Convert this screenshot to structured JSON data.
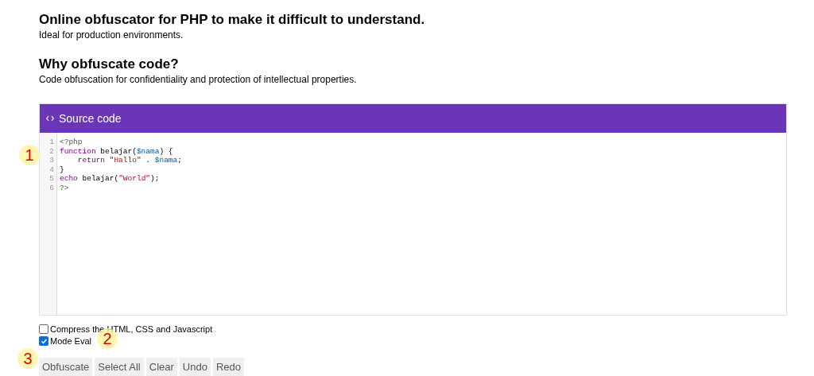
{
  "title": "Online obfuscator for PHP to make it difficult to understand.",
  "subtitle": "Ideal for production environments.",
  "why_heading": "Why obfuscate code?",
  "why_text": "Code obfuscation for confidentiality and protection of intellectual properties.",
  "editor": {
    "header": "Source code",
    "lines": [
      {
        "number": "1",
        "tokens": [
          {
            "kind": "meta",
            "text": "<?php"
          }
        ]
      },
      {
        "number": "2",
        "tokens": [
          {
            "kind": "keyword",
            "text": "function"
          },
          {
            "kind": "plain",
            "text": " belajar("
          },
          {
            "kind": "variable",
            "text": "$nama"
          },
          {
            "kind": "plain",
            "text": ") {"
          }
        ]
      },
      {
        "number": "3",
        "indented": true,
        "tokens": [
          {
            "kind": "keyword",
            "text": "return"
          },
          {
            "kind": "string",
            "text": " \"Hallo\""
          },
          {
            "kind": "plain",
            "text": " . "
          },
          {
            "kind": "variable",
            "text": "$nama"
          },
          {
            "kind": "plain",
            "text": ";"
          }
        ]
      },
      {
        "number": "4",
        "tokens": [
          {
            "kind": "plain",
            "text": "}"
          }
        ]
      },
      {
        "number": "5",
        "tokens": [
          {
            "kind": "keyword",
            "text": "echo"
          },
          {
            "kind": "plain",
            "text": " belajar("
          },
          {
            "kind": "string",
            "text": "\"World\""
          },
          {
            "kind": "plain",
            "text": ");"
          }
        ]
      },
      {
        "number": "6",
        "tokens": [
          {
            "kind": "meta",
            "text": "?>"
          }
        ]
      }
    ]
  },
  "options": [
    {
      "label": "Compress the HTML, CSS and Javascript",
      "checked": false
    },
    {
      "label": "Mode Eval",
      "checked": true
    }
  ],
  "buttons": [
    "Obfuscate",
    "Select All",
    "Clear",
    "Undo",
    "Redo"
  ],
  "markers": [
    "1",
    "2",
    "3"
  ]
}
